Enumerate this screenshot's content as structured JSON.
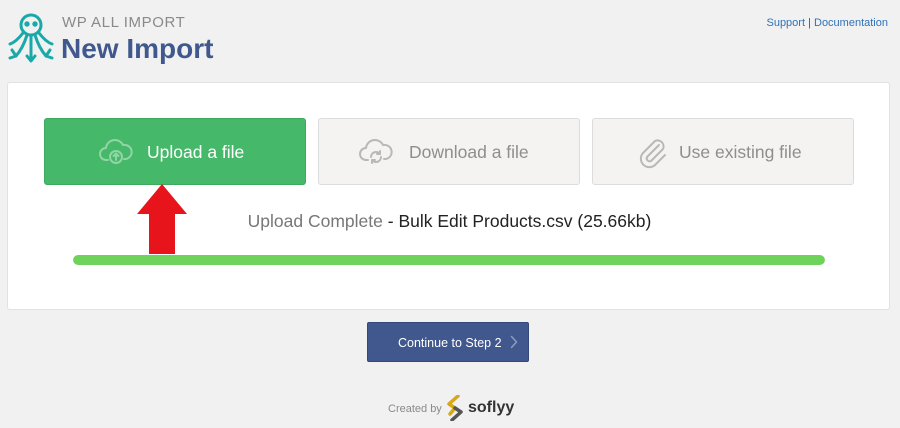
{
  "header": {
    "brand_small": "WP ALL IMPORT",
    "title": "New Import",
    "links": {
      "support": "Support",
      "separator": " | ",
      "documentation": "Documentation"
    }
  },
  "options": [
    {
      "label": "Upload a file",
      "icon": "cloud-upload-icon",
      "active": true
    },
    {
      "label": "Download a file",
      "icon": "cloud-refresh-icon",
      "active": false
    },
    {
      "label": "Use existing file",
      "icon": "paperclip-icon",
      "active": false
    }
  ],
  "upload": {
    "status_label": "Upload Complete",
    "separator": " - ",
    "file": "Bulk Edit Products.csv (25.66kb)",
    "progress": 1.0
  },
  "continue_button": {
    "label": "Continue to Step 2",
    "icon": "chevron-right-icon"
  },
  "footer": {
    "created_by": "Created by",
    "brand": "soflyy"
  },
  "colors": {
    "brand_blue": "#40588e",
    "active_green": "#46b869",
    "progress_green": "#6ed35a",
    "annotation_red": "#e8141c",
    "logo_teal": "#1aa9a9"
  }
}
